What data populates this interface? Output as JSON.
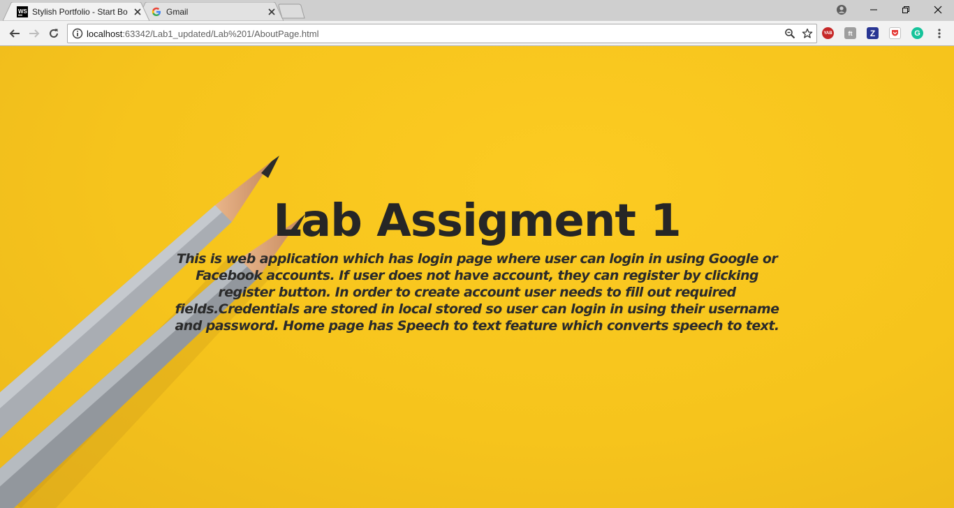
{
  "browser": {
    "tabs": [
      {
        "title": "Stylish Portfolio - Start Bo",
        "favicon": "webstorm-icon",
        "active": true
      },
      {
        "title": "Gmail",
        "favicon": "google-icon",
        "active": false
      }
    ],
    "address": {
      "host": "localhost",
      "path": ":63342/Lab1_updated/Lab%201/AboutPage.html"
    },
    "extensions": [
      {
        "name": "yab-icon",
        "label": "YAB",
        "color": "#c62828"
      },
      {
        "name": "font-ext-icon",
        "label": "ft",
        "color": "#9e9e9e"
      },
      {
        "name": "zotero-icon",
        "label": "Z",
        "color": "#283593"
      },
      {
        "name": "pocket-icon",
        "label": "",
        "color": "#e53935"
      },
      {
        "name": "grammarly-icon",
        "label": "G",
        "color": "#15c39a"
      }
    ]
  },
  "page": {
    "heading": "Lab Assigment 1",
    "description": "This is web application which has login page where user can login in using Google or Facebook accounts. If user does not have account, they can register by clicking register button. In order to create account user needs to fill out required fields.Credentials are stored in local stored so user can login in using their username and password. Home page has Speech to text feature which converts speech to text."
  }
}
